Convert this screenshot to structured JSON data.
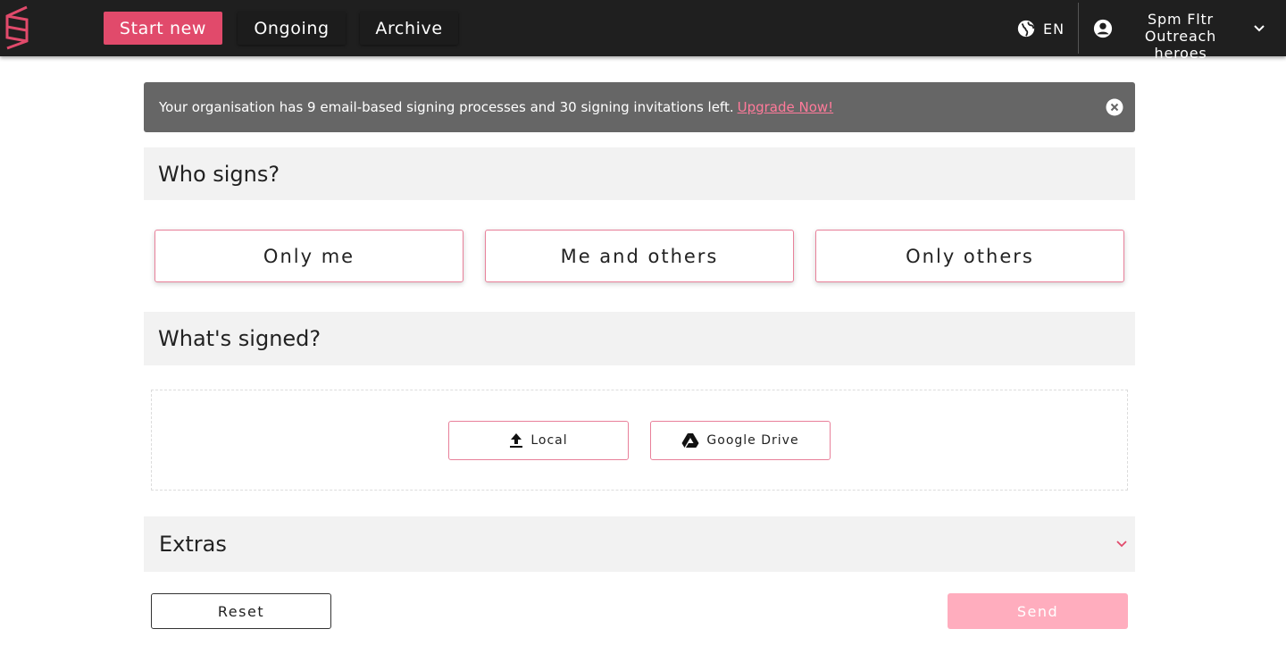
{
  "colors": {
    "accent": "#e14a6b",
    "topbar": "#1f1f1f",
    "banner": "#666666",
    "link": "#ff7a9a",
    "send_disabled": "#ffadbe"
  },
  "nav": {
    "start_new": "Start new",
    "ongoing": "Ongoing",
    "archive": "Archive"
  },
  "header": {
    "language": "EN",
    "user_name": "Spm Fltr",
    "user_org": "Outreach heroes",
    "icons": [
      "logo-icon",
      "globe-icon",
      "account-circle-icon",
      "chevron-down-icon"
    ]
  },
  "banner": {
    "message": "Your organisation has 9 email-based signing processes and 30 signing invitations left.",
    "link": "Upgrade Now!",
    "close_icon": "close-circle-icon"
  },
  "who_signs": {
    "title": "Who signs?",
    "options": [
      "Only me",
      "Me and others",
      "Only others"
    ]
  },
  "whats_signed": {
    "title": "What's signed?",
    "sources": [
      {
        "label": "Local",
        "icon": "upload-icon"
      },
      {
        "label": "Google Drive",
        "icon": "google-drive-icon"
      }
    ]
  },
  "extras": {
    "title": "Extras",
    "icon": "chevron-down-icon"
  },
  "actions": {
    "reset": "Reset",
    "send": "Send"
  }
}
